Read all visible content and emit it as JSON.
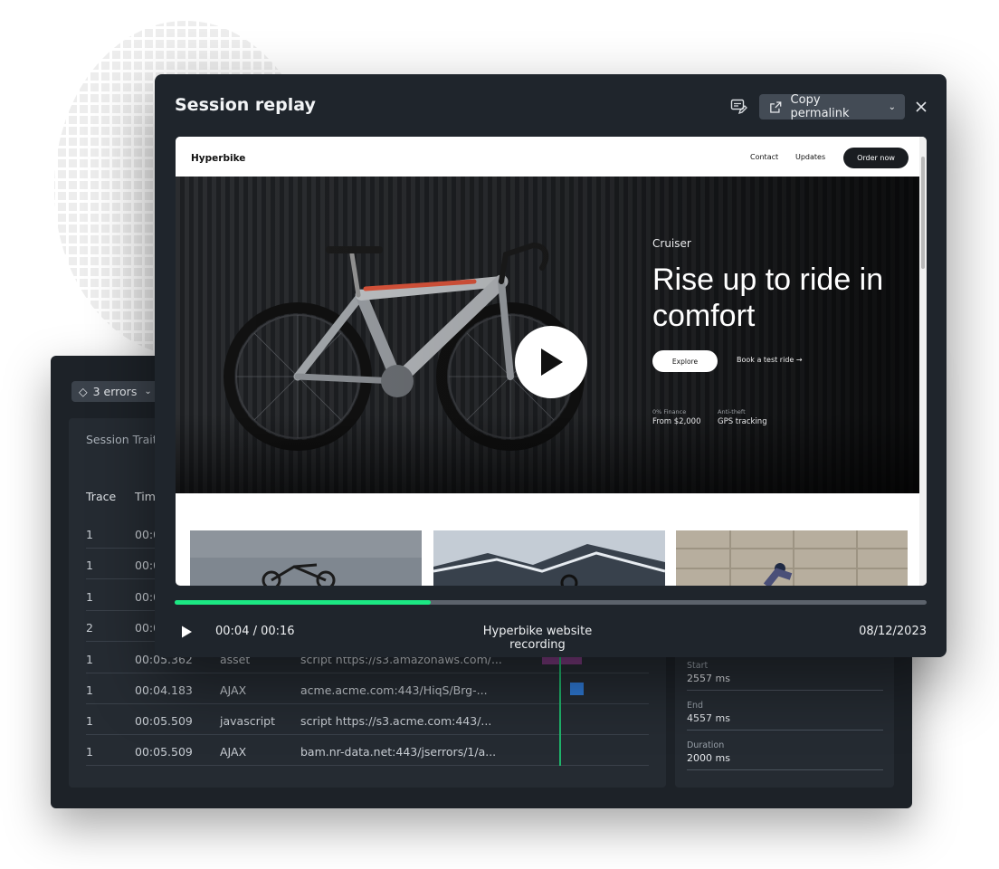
{
  "modal": {
    "title": "Session replay",
    "copy_permalink_label": "Copy permalink",
    "icons": {
      "comment": "comment-edit-icon",
      "share": "external-link-icon",
      "close": "close-icon",
      "chevron": "chevron-down-icon"
    }
  },
  "website": {
    "logo": "Hyperbike",
    "nav": [
      "Contact",
      "Updates"
    ],
    "order_label": "Order now",
    "kicker": "Cruiser",
    "headline": "Rise up to ride in comfort",
    "explore_label": "Explore",
    "test_ride_label": "Book a test ride →",
    "features": [
      {
        "label": "0% Finance",
        "value": "From $2,000"
      },
      {
        "label": "Anti-theft",
        "value": "GPS tracking"
      }
    ]
  },
  "player": {
    "time": "00:04 / 00:16",
    "title": "Hyperbike website recording",
    "date": "08/12/2023",
    "progress_fraction": 0.34,
    "accent": "#1ce783"
  },
  "background": {
    "errors_label": "3 errors",
    "traits_label": "Session Trait",
    "columns": [
      "Trace",
      "Tim"
    ],
    "rows": [
      {
        "trace": "1",
        "time": "00:0",
        "type": "",
        "url": ""
      },
      {
        "trace": "1",
        "time": "00:0",
        "type": "",
        "url": ""
      },
      {
        "trace": "1",
        "time": "00:0",
        "type": "",
        "url": ""
      },
      {
        "trace": "2",
        "time": "00:0",
        "type": "",
        "url": ""
      },
      {
        "trace": "1",
        "time": "00:05.362",
        "type": "asset",
        "url": "script https://s3.amazonaws.com/..."
      },
      {
        "trace": "1",
        "time": "00:04.183",
        "type": "AJAX",
        "url": "acme.acme.com:443/HiqS/Brg-..."
      },
      {
        "trace": "1",
        "time": "00:05.509",
        "type": "javascript",
        "url": "script https://s3.acme.com:443/..."
      },
      {
        "trace": "1",
        "time": "00:05.509",
        "type": "AJAX",
        "url": "bam.nr-data.net:443/jserrors/1/a..."
      }
    ],
    "details": [
      {
        "label": "Start",
        "value": "2557 ms"
      },
      {
        "label": "End",
        "value": "4557 ms"
      },
      {
        "label": "Duration",
        "value": "2000 ms"
      }
    ]
  }
}
